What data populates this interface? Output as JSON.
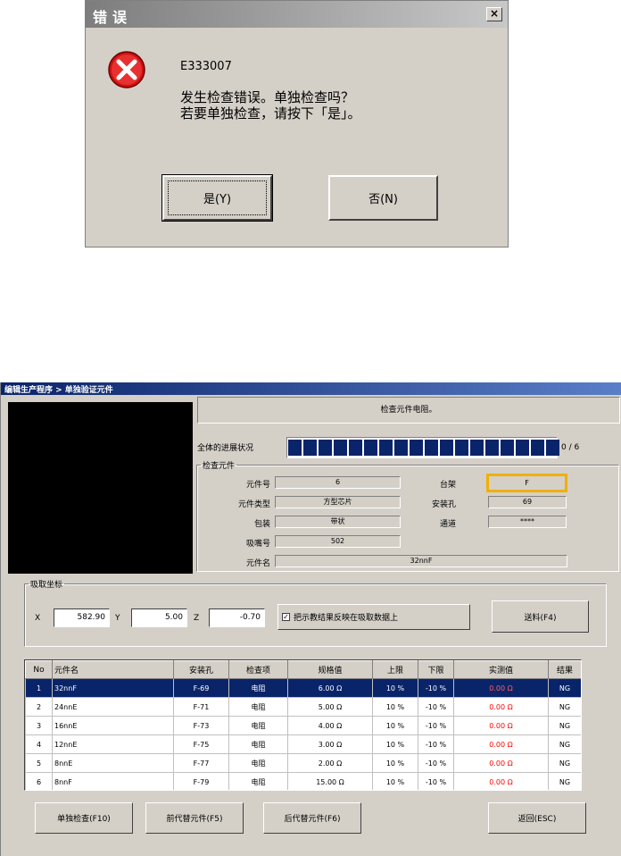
{
  "dialog": {
    "title": "错误",
    "close": "×",
    "code": "E333007",
    "line1": "发生检查错误。单独检查吗？",
    "line2": "若要单独检查，请按下「是」。",
    "yes_label": "是(Y)",
    "no_label": "否(N)"
  },
  "window": {
    "title": "编辑生产程序 > 单独验证元件",
    "message": "检查元件电阻。",
    "progress_label": "全体的进展状况",
    "progress_count": "0 / 6",
    "progress_segments": 18
  },
  "check_group": {
    "legend": "检查元件",
    "part_no_label": "元件号",
    "part_no": "6",
    "rack_label": "台架",
    "rack": "F",
    "type_label": "元件类型",
    "type": "方型芯片",
    "hole_label": "安装孔",
    "hole": "69",
    "package_label": "包装",
    "package": "带状",
    "channel_label": "通道",
    "channel": "****",
    "nozzle_label": "吸嘴号",
    "nozzle": "502",
    "name_label": "元件名",
    "name": "32nnF"
  },
  "coord_group": {
    "legend": "吸取坐标",
    "x_label": "X",
    "x": "582.90",
    "y_label": "Y",
    "y": "5.00",
    "z_label": "Z",
    "z": "-0.70",
    "reflect_label": "把示教结果反映在吸取数据上",
    "reflect_checked": "✓",
    "feed_button": "送料(F4)"
  },
  "table": {
    "headers": [
      "No",
      "元件名",
      "安装孔",
      "检查项",
      "规格值",
      "上限",
      "下限",
      "实测值",
      "结果"
    ],
    "rows": [
      [
        "1",
        "32nnF",
        "F-69",
        "电阻",
        "6.00 Ω",
        "10 %",
        "-10 %",
        "0.00 Ω",
        "NG"
      ],
      [
        "2",
        "24nnE",
        "F-71",
        "电阻",
        "5.00 Ω",
        "10 %",
        "-10 %",
        "0.00 Ω",
        "NG"
      ],
      [
        "3",
        "16nnE",
        "F-73",
        "电阻",
        "4.00 Ω",
        "10 %",
        "-10 %",
        "0.00 Ω",
        "NG"
      ],
      [
        "4",
        "12nnE",
        "F-75",
        "电阻",
        "3.00 Ω",
        "10 %",
        "-10 %",
        "0.00 Ω",
        "NG"
      ],
      [
        "5",
        "8nnE",
        "F-77",
        "电阻",
        "2.00 Ω",
        "10 %",
        "-10 %",
        "0.00 Ω",
        "NG"
      ],
      [
        "6",
        "8nnF",
        "F-79",
        "电阻",
        "15.00 Ω",
        "10 %",
        "-10 %",
        "0.00 Ω",
        "NG"
      ]
    ]
  },
  "buttons": {
    "single_check": "单独检查(F10)",
    "prev_alt": "前代替元件(F5)",
    "next_alt": "后代替元件(F6)",
    "back": "返回(ESC)"
  }
}
